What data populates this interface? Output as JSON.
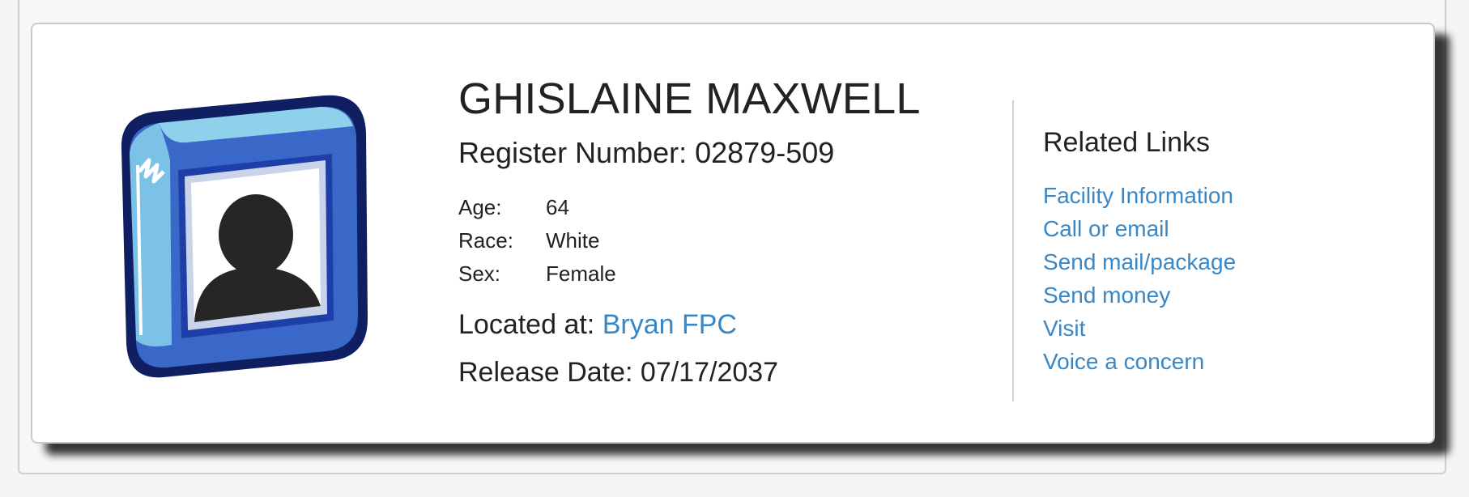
{
  "inmate": {
    "name": "GHISLAINE MAXWELL",
    "register_label": "Register Number:",
    "register_number": "02879-509",
    "details": [
      {
        "label": "Age:",
        "value": "64"
      },
      {
        "label": "Race:",
        "value": "White"
      },
      {
        "label": "Sex:",
        "value": "Female"
      }
    ],
    "located_label": "Located at:",
    "located_value": "Bryan FPC",
    "release_label": "Release Date:",
    "release_value": "07/17/2037"
  },
  "related": {
    "title": "Related Links",
    "links": [
      {
        "label": "Facility Information"
      },
      {
        "label": "Call or email"
      },
      {
        "label": "Send mail/package"
      },
      {
        "label": "Send money"
      },
      {
        "label": "Visit"
      },
      {
        "label": "Voice a concern"
      }
    ]
  },
  "colors": {
    "link": "#3a87c5",
    "text": "#222222",
    "card_border": "#c9c9c9",
    "avatar_blue": "#3a68c8",
    "avatar_dark": "#0f1f62"
  },
  "icons": {
    "avatar": "person-placeholder-icon"
  }
}
